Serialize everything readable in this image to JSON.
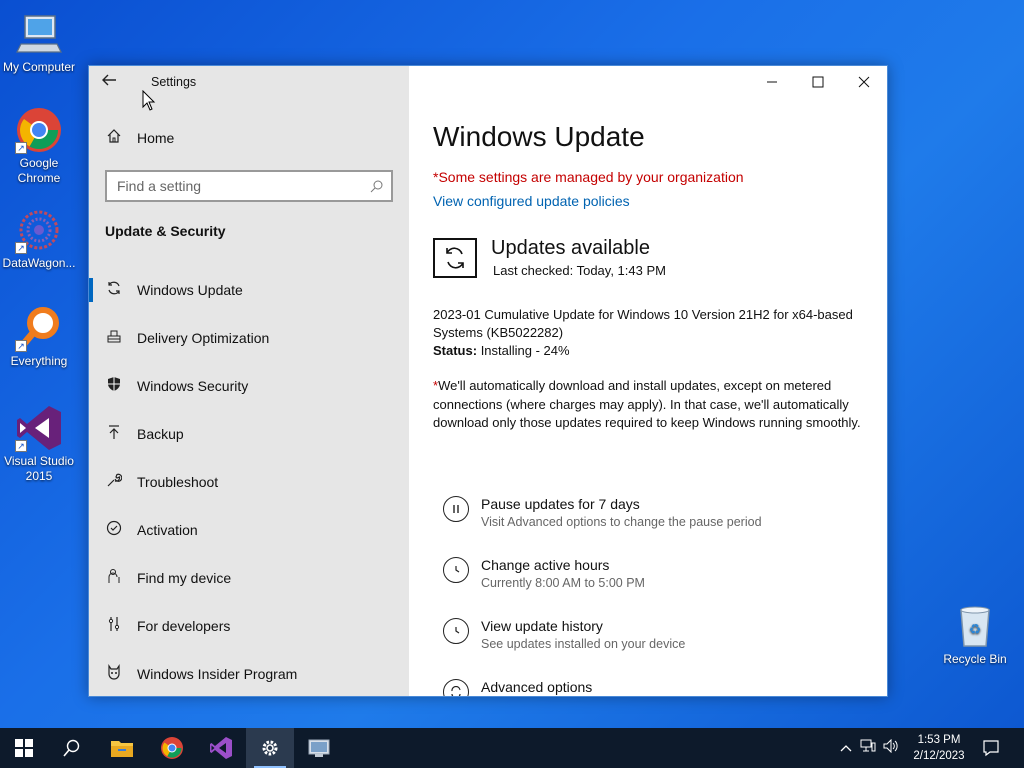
{
  "desktop": {
    "icons": [
      {
        "label": "My Computer"
      },
      {
        "label": "Google Chrome"
      },
      {
        "label": "DataWagon..."
      },
      {
        "label": "Everything"
      },
      {
        "label": "Visual Studio 2015"
      },
      {
        "label": "Recycle Bin"
      }
    ]
  },
  "window": {
    "title": "Settings",
    "controls": {
      "minimize": "–",
      "maximize": "☐",
      "close": "✕"
    }
  },
  "sidebar": {
    "home_label": "Home",
    "search_placeholder": "Find a setting",
    "section_title": "Update & Security",
    "items": [
      {
        "label": "Windows Update",
        "icon": "sync-icon",
        "active": true
      },
      {
        "label": "Delivery Optimization",
        "icon": "delivery-icon"
      },
      {
        "label": "Windows Security",
        "icon": "shield-icon"
      },
      {
        "label": "Backup",
        "icon": "backup-icon"
      },
      {
        "label": "Troubleshoot",
        "icon": "wrench-icon"
      },
      {
        "label": "Activation",
        "icon": "check-circle-icon"
      },
      {
        "label": "Find my device",
        "icon": "person-pin-icon"
      },
      {
        "label": "For developers",
        "icon": "developer-icon"
      },
      {
        "label": "Windows Insider Program",
        "icon": "insider-icon"
      }
    ]
  },
  "main": {
    "title": "Windows Update",
    "managed_notice": "*Some settings are managed by your organization",
    "policy_link": "View configured update policies",
    "status_heading": "Updates available",
    "last_checked": "Last checked: Today, 1:43 PM",
    "update_name": "2023-01 Cumulative Update for Windows 10 Version 21H2 for x64-based Systems (KB5022282)",
    "status_label": "Status:",
    "status_value": "Installing - 24%",
    "progress_percent": 24,
    "notice_asterisk": "*",
    "notice_text": "We'll automatically download and install updates, except on metered connections (where charges may apply). In that case, we'll automatically download only those updates required to keep Windows running smoothly.",
    "options": [
      {
        "title": "Pause updates for 7 days",
        "subtitle": "Visit Advanced options to change the pause period",
        "icon": "pause-icon"
      },
      {
        "title": "Change active hours",
        "subtitle": "Currently 8:00 AM to 5:00 PM",
        "icon": "clock-icon"
      },
      {
        "title": "View update history",
        "subtitle": "See updates installed on your device",
        "icon": "history-icon"
      },
      {
        "title": "Advanced options",
        "subtitle": "",
        "icon": "advanced-sync-icon"
      }
    ]
  },
  "taskbar": {
    "time": "1:53 PM",
    "date": "2/12/2023"
  }
}
